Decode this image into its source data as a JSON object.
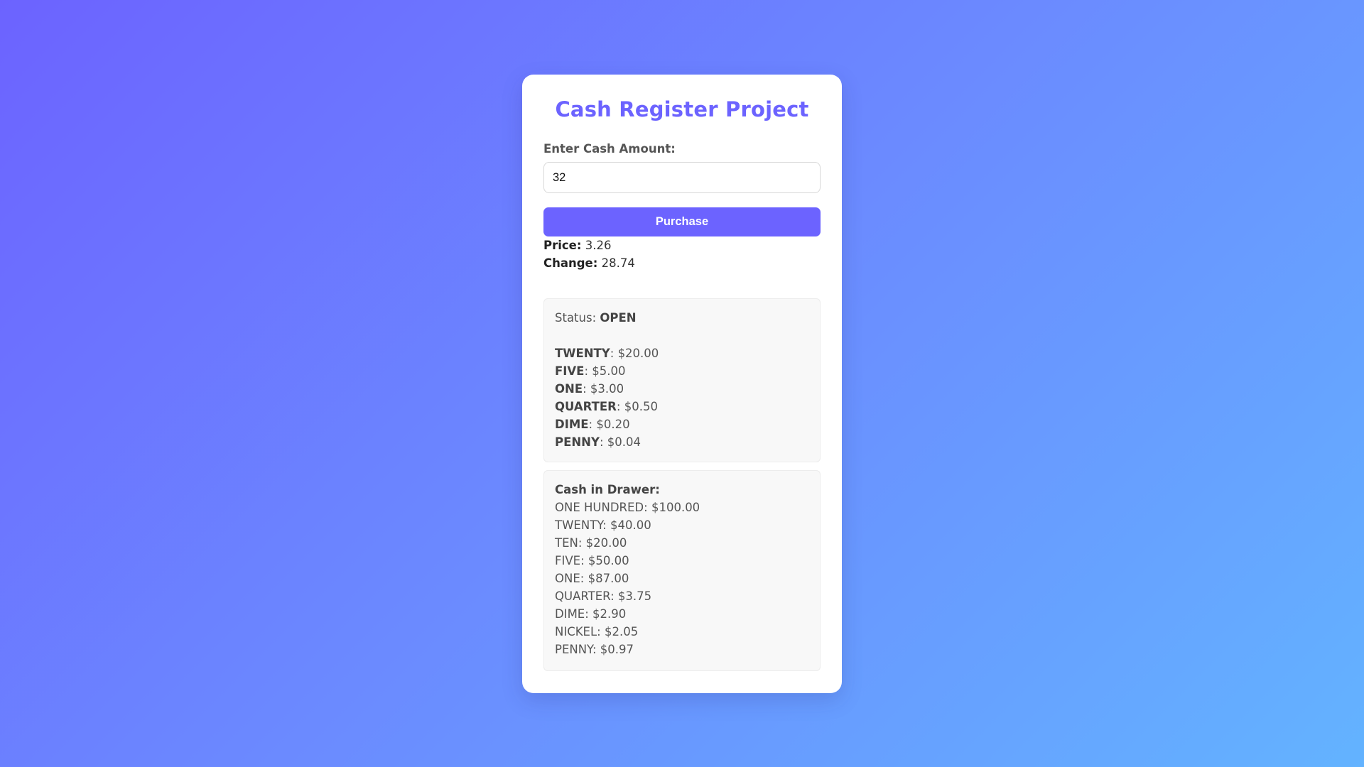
{
  "app": {
    "title": "Cash Register Project"
  },
  "form": {
    "cash_label": "Enter Cash Amount:",
    "cash_value": "32",
    "purchase_label": "Purchase"
  },
  "summary": {
    "price_label": "Price:",
    "price_value": "3.26",
    "change_label": "Change:",
    "change_value": "28.74"
  },
  "change_due": {
    "status_label": "Status:",
    "status_value": "OPEN",
    "items": [
      {
        "name": "TWENTY",
        "amount": "$20.00"
      },
      {
        "name": "FIVE",
        "amount": "$5.00"
      },
      {
        "name": "ONE",
        "amount": "$3.00"
      },
      {
        "name": "QUARTER",
        "amount": "$0.50"
      },
      {
        "name": "DIME",
        "amount": "$0.20"
      },
      {
        "name": "PENNY",
        "amount": "$0.04"
      }
    ]
  },
  "drawer": {
    "title": "Cash in Drawer:",
    "items": [
      {
        "name": "ONE HUNDRED",
        "amount": "$100.00"
      },
      {
        "name": "TWENTY",
        "amount": "$40.00"
      },
      {
        "name": "TEN",
        "amount": "$20.00"
      },
      {
        "name": "FIVE",
        "amount": "$50.00"
      },
      {
        "name": "ONE",
        "amount": "$87.00"
      },
      {
        "name": "QUARTER",
        "amount": "$3.75"
      },
      {
        "name": "DIME",
        "amount": "$2.90"
      },
      {
        "name": "NICKEL",
        "amount": "$2.05"
      },
      {
        "name": "PENNY",
        "amount": "$0.97"
      }
    ]
  },
  "colors": {
    "accent": "#6c63ff",
    "background_start": "#6c63ff",
    "background_end": "#63b3ff"
  }
}
